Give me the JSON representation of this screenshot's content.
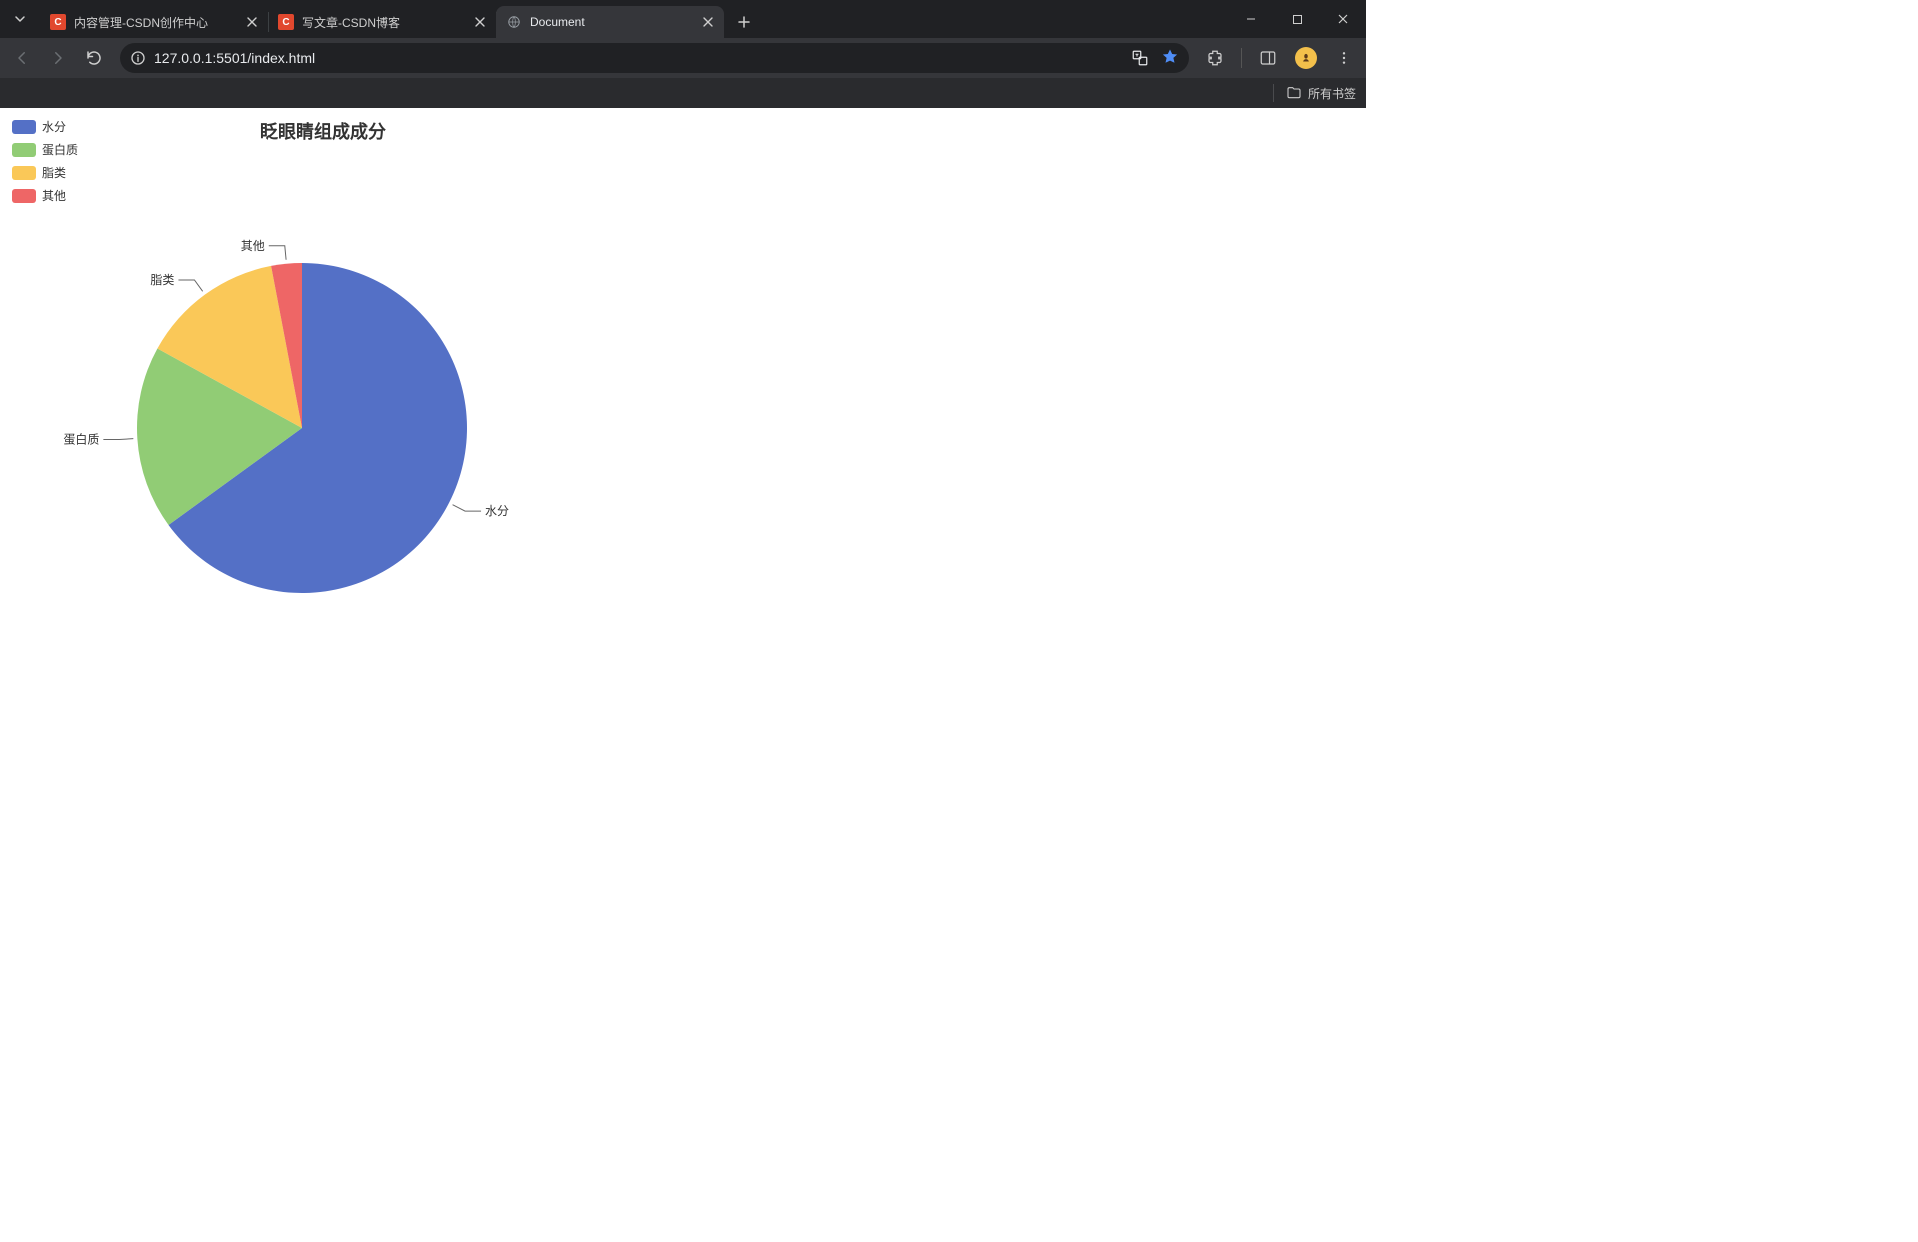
{
  "browser": {
    "tabs": [
      {
        "title": "内容管理-CSDN创作中心",
        "favicon": "csdn",
        "active": false
      },
      {
        "title": "写文章-CSDN博客",
        "favicon": "csdn",
        "active": false
      },
      {
        "title": "Document",
        "favicon": "globe",
        "active": true
      }
    ],
    "url": "127.0.0.1:5501/index.html",
    "bookmarks_label": "所有书签"
  },
  "chart_data": {
    "type": "pie",
    "title": "眨眼睛组成成分",
    "series": [
      {
        "name": "水分",
        "value": 65,
        "color": "#5470c6"
      },
      {
        "name": "蛋白质",
        "value": 18,
        "color": "#91cc75"
      },
      {
        "name": "脂类",
        "value": 14,
        "color": "#fac858"
      },
      {
        "name": "其他",
        "value": 3,
        "color": "#ee6666"
      }
    ],
    "legend_position": "top-left",
    "label_position": "outside"
  }
}
